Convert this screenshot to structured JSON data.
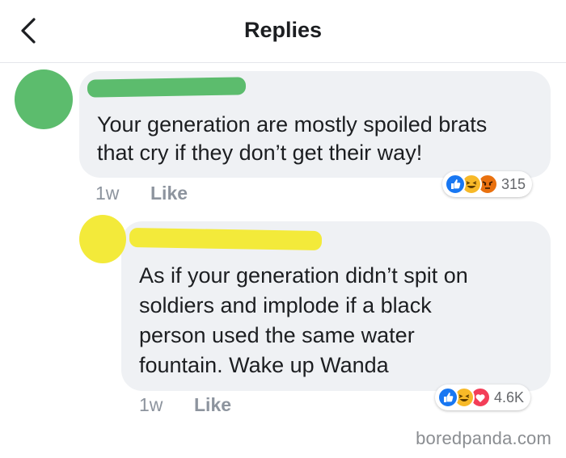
{
  "header": {
    "title": "Replies",
    "back_icon": "chevron-left-icon"
  },
  "comments": [
    {
      "avatar_color": "#5cbc6d",
      "name_redaction_color": "#5cbc6d",
      "text": "Your generation are mostly spoiled brats\nthat cry if they don’t get their way!",
      "time": "1w",
      "like_label": "Like",
      "reactions": [
        "like-icon",
        "haha-icon",
        "angry-icon"
      ],
      "reaction_count": "315"
    },
    {
      "avatar_color": "#f3ea3a",
      "name_redaction_color": "#f3ea3a",
      "text": "As if your generation didn’t spit on\nsoldiers and implode if a black\nperson used the same water\nfountain. Wake up Wanda",
      "time": "1w",
      "like_label": "Like",
      "reactions": [
        "like-icon",
        "haha-icon",
        "love-icon"
      ],
      "reaction_count": "4.6K"
    }
  ],
  "watermark": "boredpanda.com",
  "colors": {
    "bubble": "#eff1f4",
    "meta_text": "#8d949e",
    "like_blue": "#1877f2",
    "haha_yellow": "#f7b928",
    "angry_orange": "#e9710f",
    "love_red": "#f33e58"
  }
}
